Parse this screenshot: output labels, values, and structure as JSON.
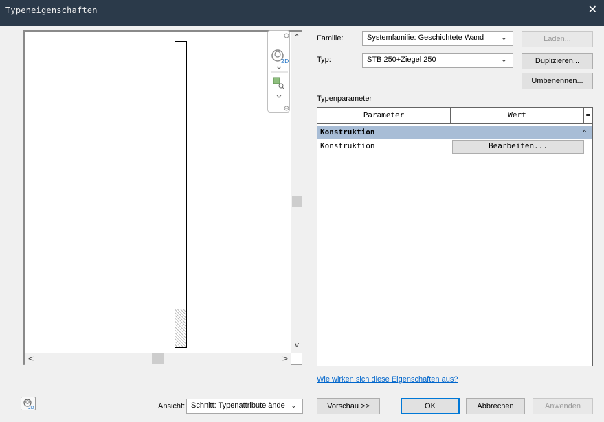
{
  "window": {
    "title": "Typeneigenschaften",
    "close_glyph": "✕"
  },
  "preview": {
    "scroll_up": "^",
    "scroll_down": "v",
    "scroll_left": "<",
    "scroll_right": ">"
  },
  "family": {
    "label": "Familie:",
    "value": "Systemfamilie: Geschichtete Wand",
    "load_button": "Laden..."
  },
  "type": {
    "label": "Typ:",
    "value": "STB 250+Ziegel 250",
    "duplicate_button": "Duplizieren...",
    "rename_button": "Umbenennen..."
  },
  "type_parameters": {
    "label": "Typenparameter",
    "columns": [
      "Parameter",
      "Wert",
      "="
    ],
    "category": {
      "name": "Konstruktion",
      "collapse_glyph": "⌃"
    },
    "rows": [
      {
        "parameter": "Konstruktion",
        "value": "Bearbeiten..."
      }
    ]
  },
  "help_link": "Wie wirken sich diese Eigenschaften aus?",
  "view": {
    "label": "Ansicht:",
    "value": "Schnitt: Typenattribute ände"
  },
  "buttons": {
    "preview": "Vorschau >>",
    "ok": "OK",
    "cancel": "Abbrechen",
    "apply": "Anwenden"
  },
  "icons": {
    "nav_wheel": "2d-navigation-wheel-icon",
    "zoom": "zoom-region-icon",
    "view_toggle": "2d-view-icon"
  },
  "colors": {
    "titlebar": "#2b3a4a",
    "category_row": "#a8bdd6",
    "link": "#0066cc",
    "default_button_border": "#0078d7"
  }
}
